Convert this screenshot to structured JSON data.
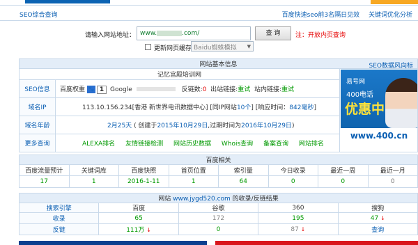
{
  "header": {
    "home_link": "SEO综合查询",
    "links": [
      "百度快速seo前3名隔日见效",
      "关键词优化分析"
    ]
  },
  "query": {
    "label": "请输入网站地址：",
    "url_prefix": "www.",
    "url_suffix": ".com/",
    "button": "查 询",
    "note": "注：开放内页查询",
    "checkbox_label": "更新网页缓存",
    "select_value": "Baidu蜘蛛模拟"
  },
  "basic": {
    "title": "网站基本信息",
    "title_link": "SEO数据风向标",
    "site_name": "记忆宫殿培训网",
    "seo_label": "SEO信息",
    "seo": {
      "baidu_weight_label": "百度权重",
      "baidu_weight": "1",
      "google_label": "Google",
      "backlinks_label": "反链数:",
      "backlinks": "0",
      "outlinks_label": "出站链接:",
      "outlinks": "重试",
      "inlinks_label": "站内链接:",
      "inlinks": "重试"
    },
    "ip_label": "域名IP",
    "ip": {
      "addr": "113.10.156.234",
      "location": "[香港 新世界电讯数据中心]",
      "same_ip": "[同IP网站",
      "same_ip_count": "10个",
      "same_ip_end": "]",
      "resp_label": "[响应时间：",
      "resp_value": "842毫秒",
      "resp_end": "]"
    },
    "age_label": "域名年龄",
    "age": {
      "value": "2月25天",
      "created_label": "( 创建于",
      "created": "2015年10月29日",
      "expire_label": ",过期时间为",
      "expire": "2016年10月29日",
      "end": ")"
    },
    "more_label": "更多查询",
    "more_links": [
      "ALEXA排名",
      "友情链接检测",
      "网站历史数据",
      "Whois查询",
      "备案查询",
      "网站排名"
    ]
  },
  "ad": {
    "line1": "易号网",
    "line2": "400电话",
    "line3": "优惠中",
    "banner": "www.400.cn"
  },
  "rank": {
    "title": "百度相关",
    "columns": [
      "百度流量预计",
      "关键词库",
      "百度快照",
      "首页位置",
      "索引量",
      "今日收录",
      "最近一周",
      "最近一月"
    ],
    "values": [
      "17",
      "1",
      "2016-1-11",
      "1",
      "64",
      "0",
      "0",
      "0"
    ]
  },
  "inclusion": {
    "title_prefix": "网站",
    "title_site": "www.jygd520.com",
    "title_suffix": "的收录/反链结果",
    "columns": [
      "搜索引擎",
      "百度",
      "谷歌",
      "360",
      "搜狗"
    ],
    "rows": [
      {
        "label": "收录",
        "values": [
          "65",
          "172",
          "195",
          "47"
        ]
      },
      {
        "label": "反链",
        "values": [
          "111万",
          "0",
          "87",
          "查询"
        ]
      }
    ]
  }
}
